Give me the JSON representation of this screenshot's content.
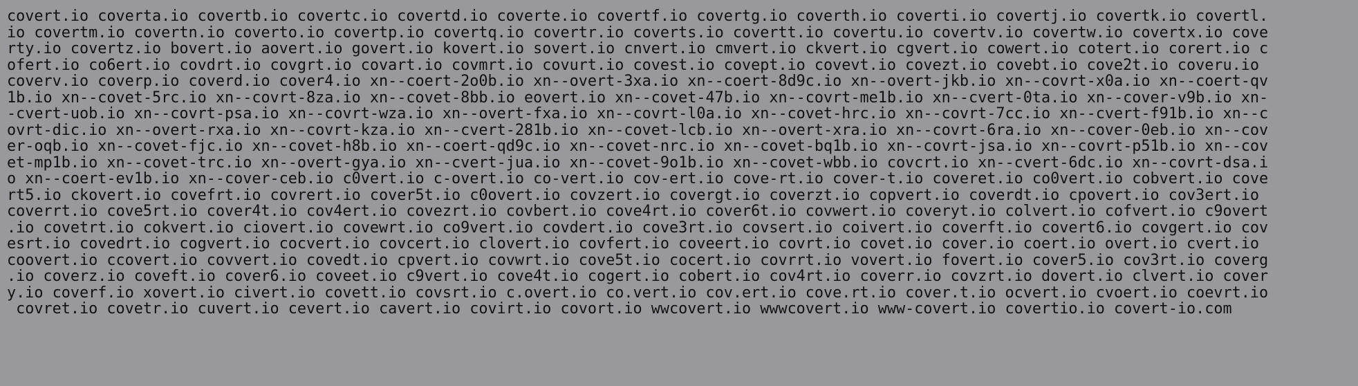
{
  "terminal": {
    "lines": [
      "covert.io coverta.io covertb.io covertc.io covertd.io coverte.io covertf.io covertg.io coverth.io coverti.io covertj.io covertk.io covertl.",
      "io covertm.io covertn.io coverto.io covertp.io covertq.io covertr.io coverts.io covertt.io covertu.io covertv.io covertw.io covertx.io cove",
      "rty.io covertz.io bovert.io aovert.io govert.io kovert.io sovert.io cnvert.io cmvert.io ckvert.io cgvert.io cowert.io cotert.io corert.io c",
      "ofert.io co6ert.io covdrt.io covgrt.io covart.io covmrt.io covurt.io covest.io covept.io covevt.io covezt.io covebt.io cove2t.io coveru.io ",
      "coverv.io coverp.io coverd.io cover4.io xn--coert-2o0b.io xn--overt-3xa.io xn--coert-8d9c.io xn--overt-jkb.io xn--covrt-x0a.io xn--coert-qv",
      "1b.io xn--covet-5rc.io xn--covrt-8za.io xn--covet-8bb.io eovert.io xn--covet-47b.io xn--covrt-me1b.io xn--cvert-0ta.io xn--cover-v9b.io xn-",
      "-cvert-uob.io xn--covrt-psa.io xn--covrt-wza.io xn--overt-fxa.io xn--covrt-l0a.io xn--covet-hrc.io xn--covrt-7cc.io xn--cvert-f91b.io xn--c",
      "ovrt-dic.io xn--overt-rxa.io xn--covrt-kza.io xn--cvert-281b.io xn--covet-lcb.io xn--overt-xra.io xn--covrt-6ra.io xn--cover-0eb.io xn--cov",
      "er-oqb.io xn--covet-fjc.io xn--covet-h8b.io xn--coert-qd9c.io xn--covet-nrc.io xn--covet-bq1b.io xn--covrt-jsa.io xn--covrt-p51b.io xn--cov",
      "et-mp1b.io xn--covet-trc.io xn--overt-gya.io xn--cvert-jua.io xn--covet-9o1b.io xn--covet-wbb.io covcrt.io xn--cvert-6dc.io xn--covrt-dsa.i",
      "o xn--coert-ev1b.io xn--cover-ceb.io c0vert.io c-overt.io co-vert.io cov-ert.io cove-rt.io cover-t.io coveret.io co0vert.io cobvert.io cove",
      "rt5.io ckovert.io covefrt.io covrert.io cover5t.io c0overt.io covzert.io covergt.io coverzt.io copvert.io coverdt.io cpovert.io cov3ert.io ",
      "coverrt.io cove5rt.io cover4t.io cov4ert.io covezrt.io covbert.io cove4rt.io cover6t.io covwert.io coveryt.io colvert.io cofvert.io c9overt",
      ".io covetrt.io cokvert.io ciovert.io covewrt.io co9vert.io covdert.io cove3rt.io covsert.io coivert.io coverft.io covert6.io covgert.io cov",
      "esrt.io covedrt.io cogvert.io cocvert.io covcert.io clovert.io covfert.io coveert.io covrt.io covet.io cover.io coert.io overt.io cvert.io ",
      "coovert.io ccovert.io covvert.io covedt.io cpvert.io covwrt.io cove5t.io cocert.io covrrt.io vovert.io fovert.io cover5.io cov3rt.io coverg",
      ".io coverz.io coveft.io cover6.io coveet.io c9vert.io cove4t.io cogert.io cobert.io cov4rt.io coverr.io covzrt.io dovert.io clvert.io cover",
      "y.io coverf.io xovert.io civert.io covett.io covsrt.io c.overt.io co.vert.io cov.ert.io cove.rt.io cover.t.io ocvert.io cvoert.io coevrt.io",
      " covret.io covetr.io cuvert.io cevert.io cavert.io covirt.io covort.io wwcovert.io wwwcovert.io www-covert.io covertio.io covert-io.com"
    ]
  }
}
